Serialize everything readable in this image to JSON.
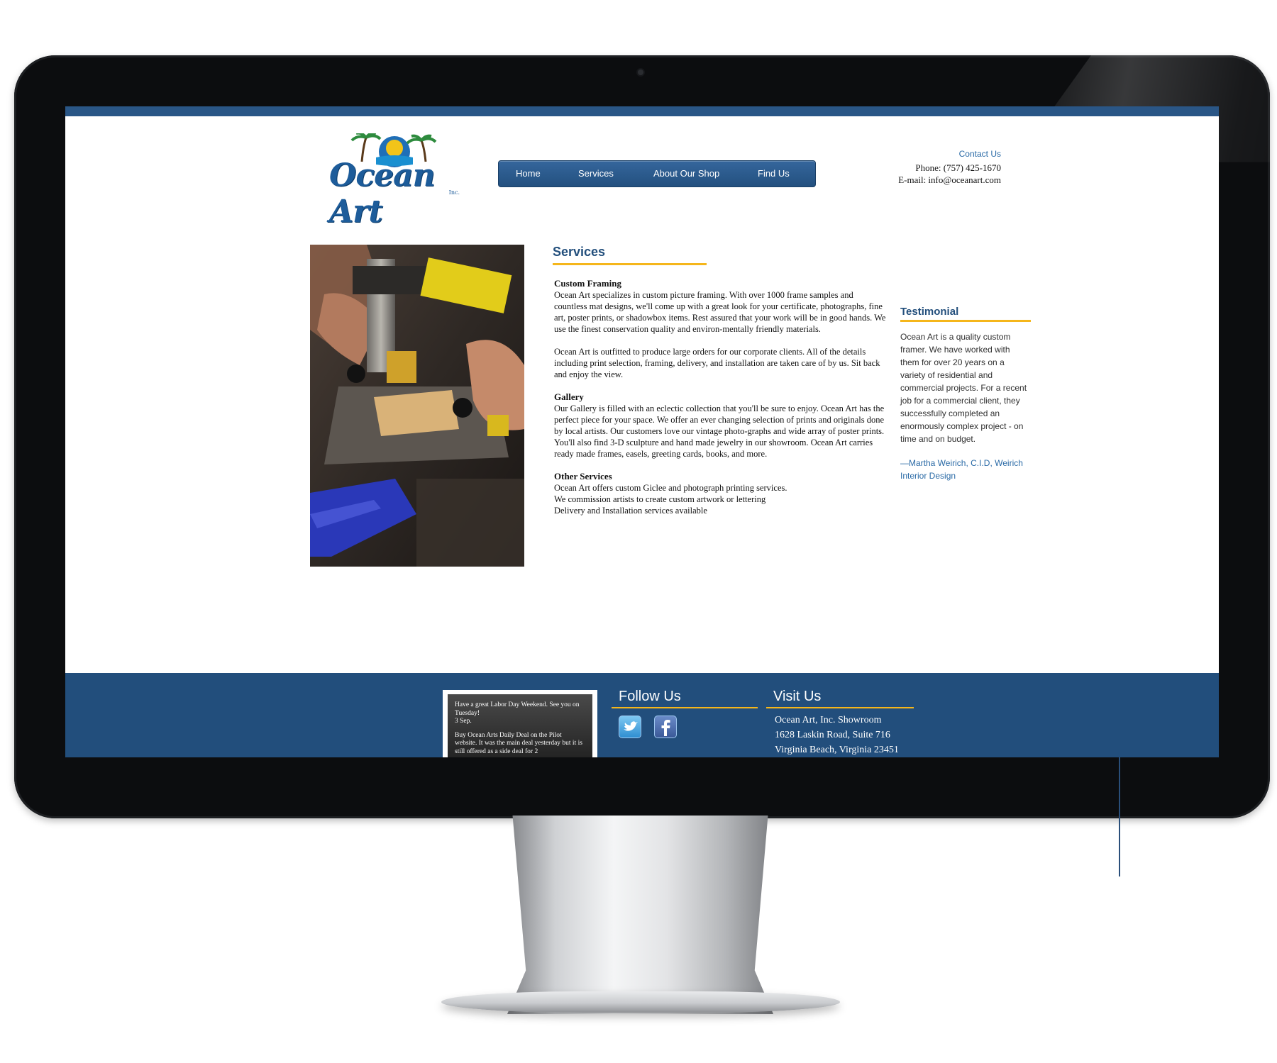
{
  "header": {
    "logo_text": "Ocean Art",
    "logo_suffix": "Inc.",
    "nav": [
      {
        "label": "Home"
      },
      {
        "label": "Services"
      },
      {
        "label": "About Our Shop"
      },
      {
        "label": "Find Us"
      }
    ],
    "contact": {
      "heading": "Contact Us",
      "phone": "Phone: (757) 425-1670",
      "email": "E-mail: info@oceanart.com"
    }
  },
  "services": {
    "title": "Services",
    "sections": [
      {
        "heading": "Custom Framing",
        "paragraphs": [
          "Ocean Art specializes in custom picture framing. With over 1000 frame samples and countless mat designs, we'll come up with a great look for your certificate, photographs, fine art, poster prints, or shadowbox items. Rest assured that your work will be in good hands. We use the finest conservation quality and environ-mentally friendly materials.",
          "Ocean Art is outfitted to produce large orders for our corporate clients. All of the details including print selection, framing, delivery, and installation are taken care of by us. Sit back and enjoy the view."
        ]
      },
      {
        "heading": "Gallery",
        "paragraphs": [
          "Our Gallery is filled with an eclectic collection that you'll be sure to enjoy. Ocean Art has the perfect piece for your space. We offer an ever changing selection of prints and originals done by local artists. Our customers love our vintage photo-graphs and wide array of poster prints. You'll also find 3-D sculpture and hand made jewelry in our showroom. Ocean Art carries ready made frames, easels, greeting cards, books, and more."
        ]
      },
      {
        "heading": "Other Services",
        "lines": [
          "Ocean Art offers custom Giclee and photograph printing services.",
          "We commission artists to create custom artwork or lettering",
          "Delivery and Installation services available"
        ]
      }
    ]
  },
  "testimonial": {
    "title": "Testimonial",
    "body": "Ocean Art is a quality custom framer. We have worked with them for over 20 years on a variety of residential and commercial projects. For a recent job for a commercial client, they successfully completed an enormously complex project - on time and on budget.",
    "author": "—Martha Weirich, C.I.D, Weirich Interior Design"
  },
  "footer": {
    "news": [
      "Have a great Labor Day Weekend. See you on Tuesday!",
      "3 Sep.",
      "Buy Ocean Arts Daily Deal on the Pilot website. It was the main deal yesterday but it is still offered as a side deal for 2"
    ],
    "follow_title": "Follow Us",
    "visit_title": "Visit Us",
    "address": [
      "Ocean Art, Inc. Showroom",
      "1628 Laskin Road, Suite 716",
      "Virginia Beach, Virginia 23451"
    ]
  },
  "colors": {
    "brand_blue": "#224e7c",
    "accent_gold": "#f5b61b",
    "link_blue": "#2a6aa6"
  },
  "icons": [
    "twitter-icon",
    "facebook-icon",
    "ocean-art-logo"
  ]
}
